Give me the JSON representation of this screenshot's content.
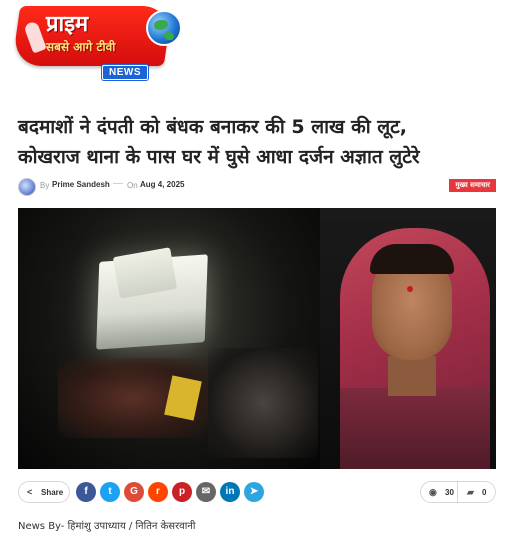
{
  "logo": {
    "hindi_title": "प्राइम",
    "tagline": "सबसे आगे टीवी",
    "badge": "NEWS"
  },
  "article": {
    "headline_line1": "बदमाशों ने दंपती को बंधक बनाकर की 5 लाख की लूट,",
    "headline_line2": "कोखराज थाना के पास घर में घुसे आधा दर्जन अज्ञात लुटेरे",
    "by_label": "By",
    "author": "Prime Sandesh",
    "dash": "—",
    "on_label": "On",
    "date": "Aug 4, 2025",
    "category": "मुख्य समाचार",
    "byline": "News By- हिमांशु उपाध्याय / नितिन केसरवानी"
  },
  "share": {
    "label": "Share",
    "icons": {
      "facebook": "f",
      "twitter": "t",
      "google": "G",
      "reddit": "r",
      "pinterest": "p",
      "email": "✉",
      "linkedin": "in",
      "telegram": "➤"
    }
  },
  "stats": {
    "views": "30",
    "comments": "0"
  },
  "colors": {
    "accent_red": "#e8363c",
    "logo_blue": "#1c64d6"
  }
}
